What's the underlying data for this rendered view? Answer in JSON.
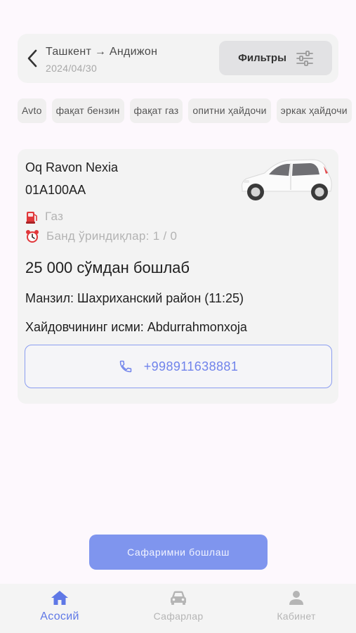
{
  "header": {
    "route": "Ташкент → Андижон",
    "date": "2024/04/30",
    "filter_label": "Фильтры"
  },
  "chips": [
    "Avto",
    "фақат бензин",
    "фақат газ",
    "опитни ҳайдочи",
    "эркак ҳайдочи"
  ],
  "trip": {
    "car_name": "Oq Ravon Nexia",
    "plate": "01A100AA",
    "fuel": "Газ",
    "seats": "Банд ўриндиқлар: 1 / 0",
    "price": "25 000 сўмдан бошлаб",
    "address": "Манзил: Шахриханский район (11:25)",
    "driver": "Хайдовчининг исми: Abdurrahmonxoja",
    "phone": "+998911638881"
  },
  "start_button": "Сафаримни бошлаш",
  "tabs": [
    {
      "label": "Асосий",
      "active": true
    },
    {
      "label": "Сафарлар",
      "active": false
    },
    {
      "label": "Кабинет",
      "active": false
    }
  ],
  "colors": {
    "accent": "#5f78e6",
    "button": "#7f95ee",
    "card": "#f3f3f3",
    "background": "#fdf8fd"
  }
}
